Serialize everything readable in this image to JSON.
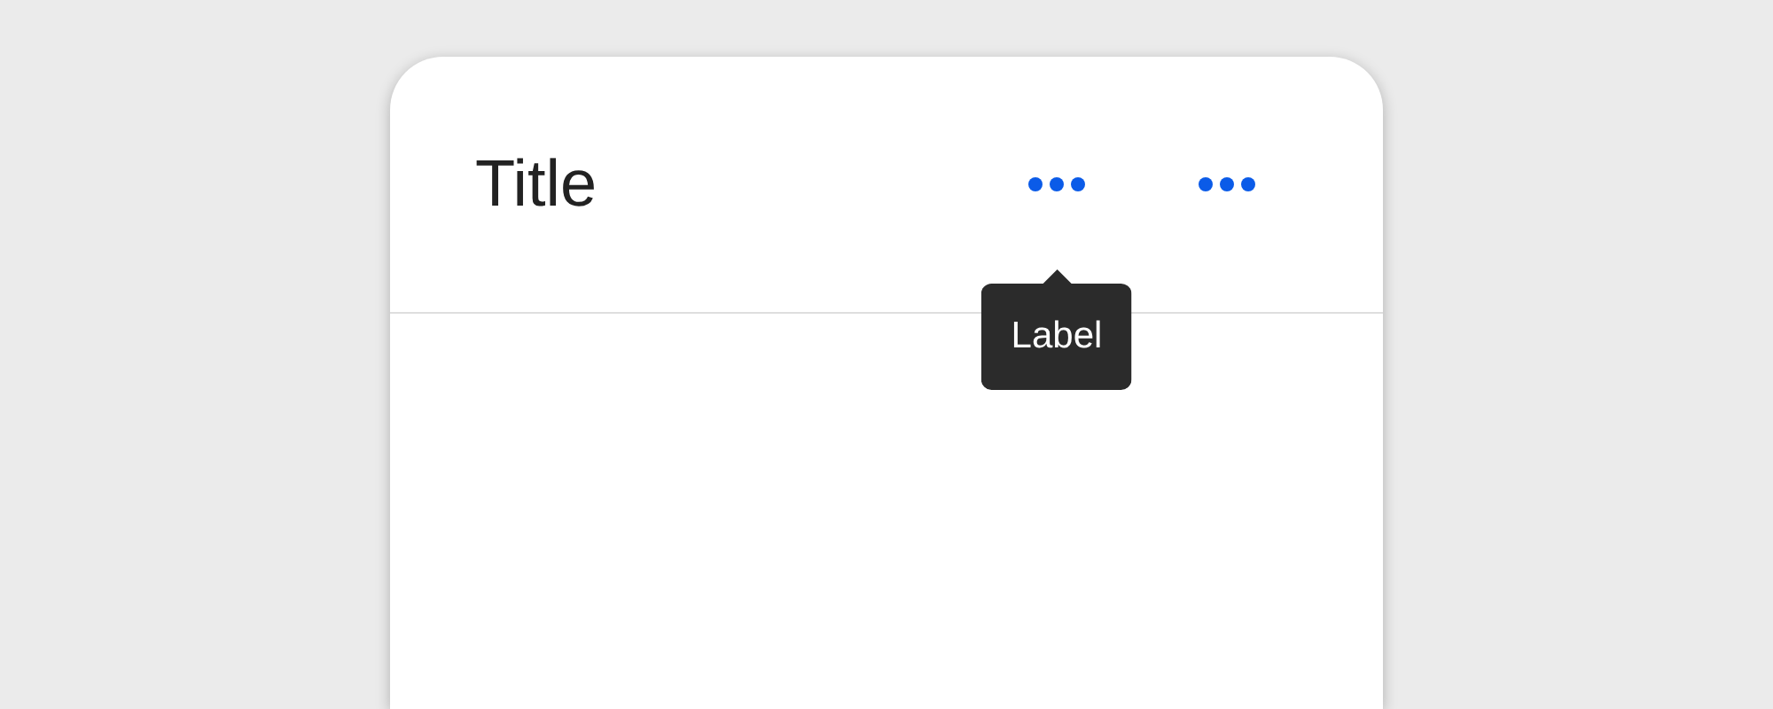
{
  "card": {
    "title": "Title",
    "actions": [
      {
        "kind": "more",
        "tooltip": "Label"
      },
      {
        "kind": "more"
      }
    ]
  }
}
